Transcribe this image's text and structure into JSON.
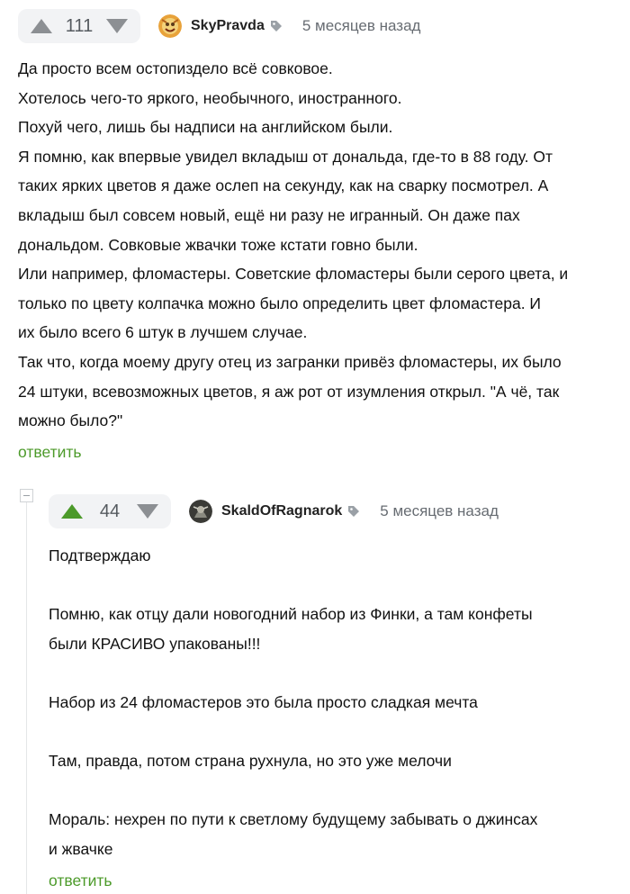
{
  "comments": [
    {
      "rating": "111",
      "username": "SkyPravda",
      "time": "5 месяцев назад",
      "lines": [
        "Да просто всем остопиздело всё совковое.",
        "Хотелось чего-то яркого, необычного, иностранного.",
        "Похуй чего, лишь бы надписи на английском были.",
        "Я помню, как впервые увидел вкладыш от дональда, где-то в 88 году. От",
        "таких ярких цветов я даже ослеп на секунду, как на сварку посмотрел. А",
        "вкладыш был совсем новый, ещё ни разу не игранный. Он даже пах",
        "дональдом. Совковые жвачки тоже кстати говно были.",
        "Или например, фломастеры. Советские фломастеры были серого цвета, и",
        "только по цвету колпачка можно было определить цвет фломастера. И",
        "их было всего 6 штук в лучшем случае.",
        "Так что, когда моему другу отец из загранки привёз фломастеры, их было",
        "24 штуки, всевозможных цветов, я аж рот от изумления открыл. \"А чё, так",
        "можно было?\""
      ],
      "reply_label": "ответить"
    },
    {
      "rating": "44",
      "username": "SkaldOfRagnarok",
      "time": "5 месяцев назад",
      "lines": [
        "Подтверждаю",
        "",
        "Помню, как отцу дали новогодний набор из Финки, а там конфеты",
        "были КРАСИВО упакованы!!!",
        "",
        "Набор из 24 фломастеров это была просто сладкая мечта",
        "",
        "Там, правда, потом страна рухнула, но это уже мелочи",
        "",
        "Мораль: нехрен по пути к светлому будущему забывать о джинсах",
        "и жвачке"
      ],
      "reply_label": "ответить"
    }
  ],
  "colors": {
    "accent_green": "#4c9a2a",
    "rating_bg": "#f2f3f5",
    "muted_text": "#676c72"
  },
  "icons": [
    "arrow-up-icon",
    "arrow-down-icon",
    "tag-icon",
    "collapse-icon"
  ]
}
